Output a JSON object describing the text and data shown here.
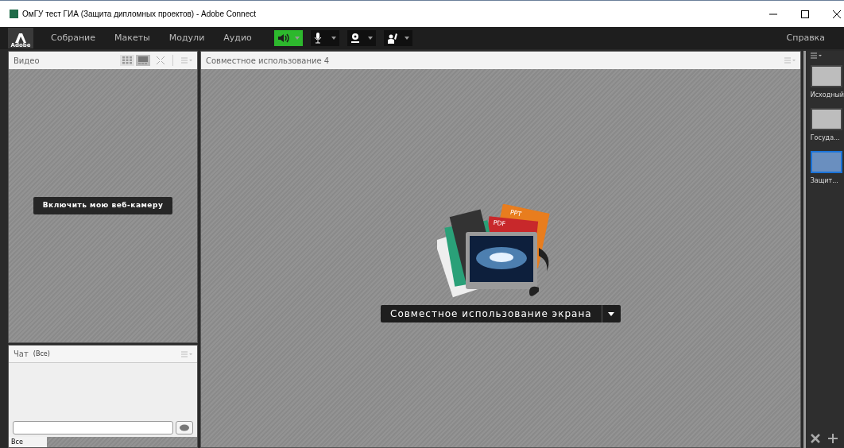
{
  "window": {
    "title": "ОмГУ тест ГИА (Защита дипломных проектов) - Adobe Connect"
  },
  "logo": {
    "text": "Adobe"
  },
  "menu": [
    {
      "label": "Собрание"
    },
    {
      "label": "Макеты"
    },
    {
      "label": "Модули"
    },
    {
      "label": "Аудио"
    }
  ],
  "toolbar": [
    {
      "kind": "speaker",
      "on": true
    },
    {
      "kind": "microphone",
      "on": false
    },
    {
      "kind": "camera",
      "on": false
    },
    {
      "kind": "raise-hand",
      "on": false
    }
  ],
  "help": "Справка",
  "video_pod": {
    "title": "Видео",
    "views": [
      {
        "kind": "grid",
        "selected": false
      },
      {
        "kind": "single",
        "selected": true
      }
    ],
    "button": "Включить мою веб-камеру"
  },
  "chat_pod": {
    "title": "Чат",
    "scope": "(Все)",
    "tabs": [
      {
        "label": "Все",
        "selected": true
      }
    ]
  },
  "share_pod": {
    "title": "Совместное использование 4",
    "illustration_labels": [
      "PPT",
      "PDF"
    ],
    "button": "Совместное использование экрана"
  },
  "layouts": [
    {
      "label": "Исходный",
      "selected": false
    },
    {
      "label": "Госуда...",
      "selected": false
    },
    {
      "label": "Защит...",
      "selected": true
    }
  ]
}
